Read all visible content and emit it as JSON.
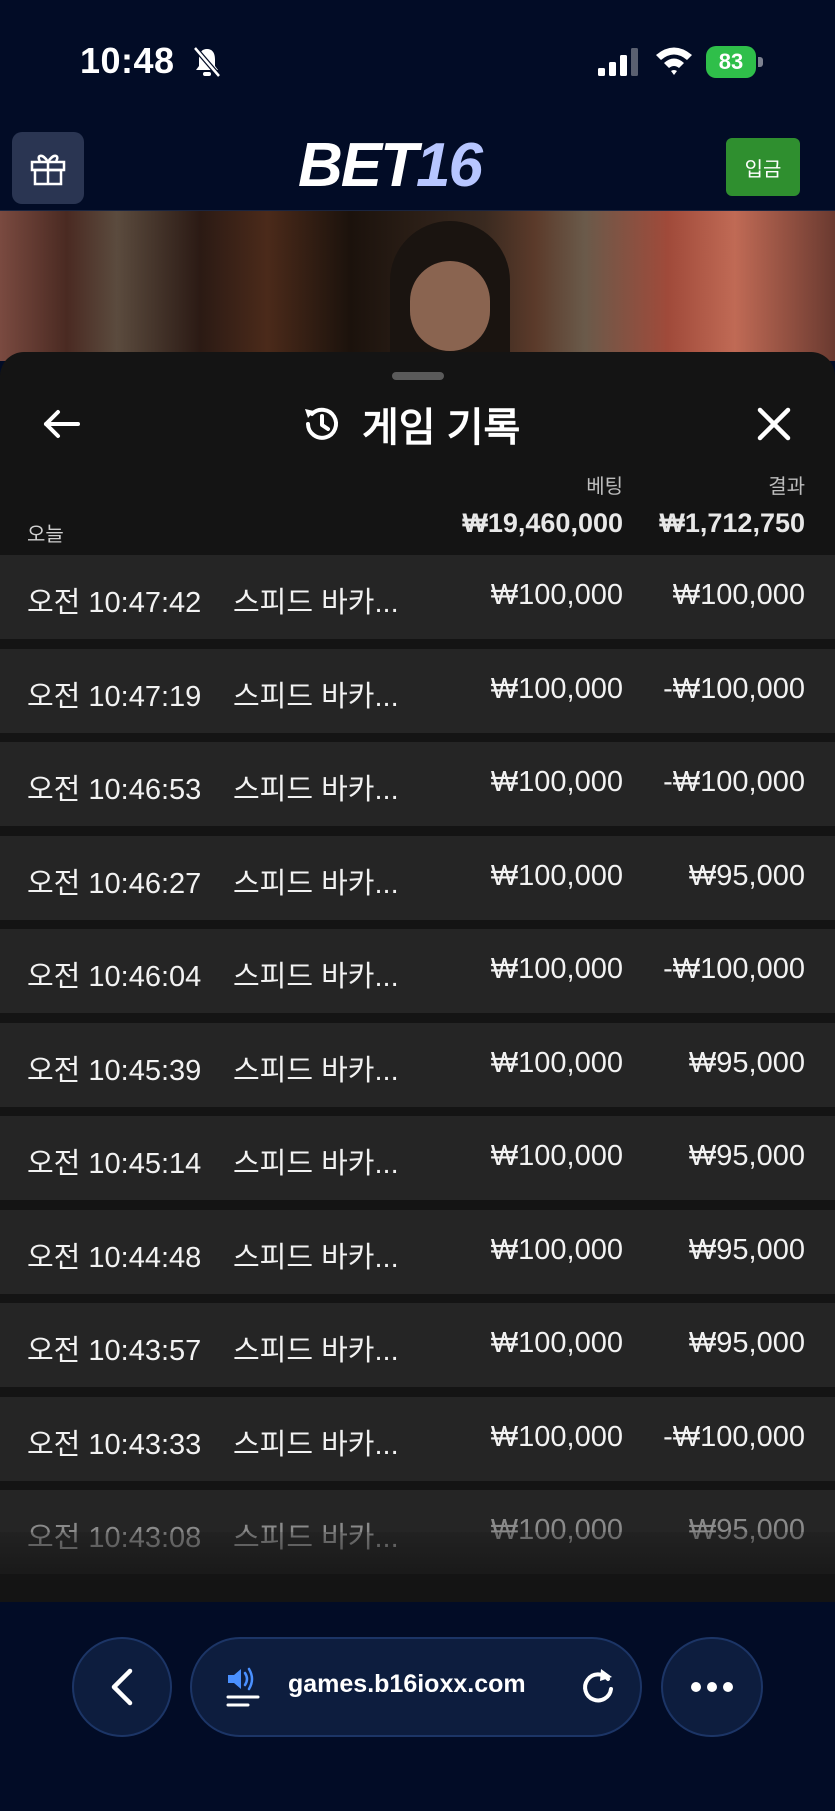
{
  "status_bar": {
    "time": "10:48",
    "battery": "83"
  },
  "header": {
    "logo_part1": "BET",
    "logo_part2": "16",
    "deposit_label": "입금"
  },
  "panel": {
    "title": "게임 기록",
    "summary": {
      "bet_header": "베팅",
      "result_header": "결과",
      "today_label": "오늘",
      "total_bet": "₩19,460,000",
      "total_result": "₩1,712,750"
    },
    "rows": [
      {
        "time": "오전 10:47:42",
        "game": "스피드 바카...",
        "bet": "₩100,000",
        "result": "₩100,000"
      },
      {
        "time": "오전 10:47:19",
        "game": "스피드 바카...",
        "bet": "₩100,000",
        "result": "-₩100,000"
      },
      {
        "time": "오전 10:46:53",
        "game": "스피드 바카...",
        "bet": "₩100,000",
        "result": "-₩100,000"
      },
      {
        "time": "오전 10:46:27",
        "game": "스피드 바카...",
        "bet": "₩100,000",
        "result": "₩95,000"
      },
      {
        "time": "오전 10:46:04",
        "game": "스피드 바카...",
        "bet": "₩100,000",
        "result": "-₩100,000"
      },
      {
        "time": "오전 10:45:39",
        "game": "스피드 바카...",
        "bet": "₩100,000",
        "result": "₩95,000"
      },
      {
        "time": "오전 10:45:14",
        "game": "스피드 바카...",
        "bet": "₩100,000",
        "result": "₩95,000"
      },
      {
        "time": "오전 10:44:48",
        "game": "스피드 바카...",
        "bet": "₩100,000",
        "result": "₩95,000"
      },
      {
        "time": "오전 10:43:57",
        "game": "스피드 바카...",
        "bet": "₩100,000",
        "result": "₩95,000"
      },
      {
        "time": "오전 10:43:33",
        "game": "스피드 바카...",
        "bet": "₩100,000",
        "result": "-₩100,000"
      },
      {
        "time": "오전 10:43:08",
        "game": "스피드 바카...",
        "bet": "₩100,000",
        "result": "₩95,000"
      }
    ]
  },
  "browser": {
    "url": "games.b16ioxx.com"
  },
  "icons": {
    "bell": "bell-off-icon",
    "signal": "signal-icon",
    "wifi": "wifi-icon",
    "gift": "gift-icon",
    "back": "arrow-left-icon",
    "history": "history-icon",
    "close": "close-icon",
    "nav_back": "chevron-left-icon",
    "speaker": "speaker-icon",
    "reload": "reload-icon",
    "more": "more-icon"
  },
  "colors": {
    "background": "#020c26",
    "deposit": "#2f8f2f",
    "logo_accent": "#b7c6ff",
    "battery": "#2fbf4a",
    "row": "#252525"
  }
}
